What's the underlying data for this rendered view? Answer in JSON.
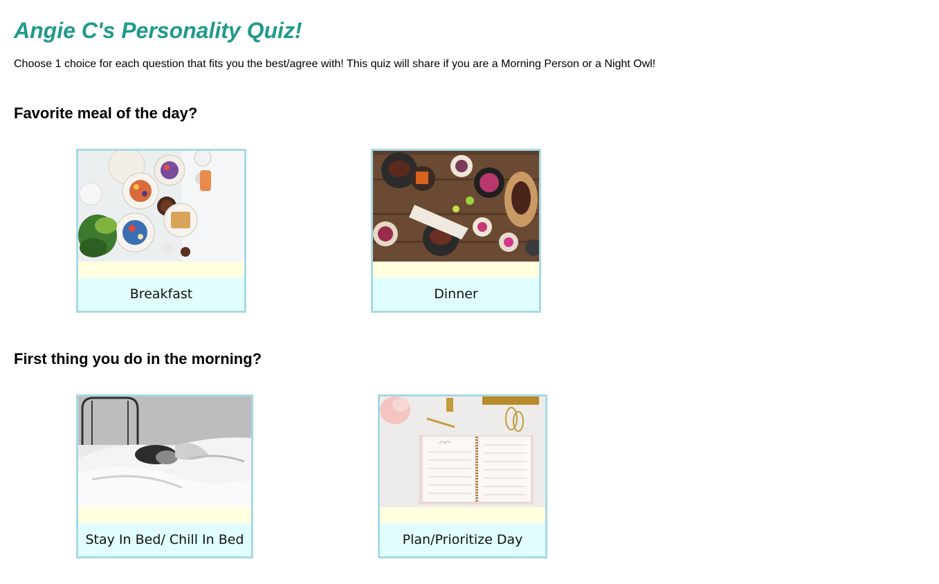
{
  "quiz": {
    "title": "Angie C's Personality Quiz!",
    "intro": "Choose 1 choice for each question that fits you the best/agree with! This quiz will share if you are a Morning Person or a Night Owl!"
  },
  "questions": [
    {
      "text": "Favorite meal of the day?",
      "choices": [
        {
          "label": "Breakfast",
          "image": "breakfast-table-photo"
        },
        {
          "label": "Dinner",
          "image": "dinner-table-photo"
        }
      ]
    },
    {
      "text": "First thing you do in the morning?",
      "choices": [
        {
          "label": "Stay In Bed/ Chill In Bed",
          "image": "person-in-bed-photo"
        },
        {
          "label": "Plan/Prioritize Day",
          "image": "planner-notebook-photo"
        }
      ]
    }
  ],
  "colors": {
    "title": "#1f9a8a",
    "card_border": "#a8d8e4",
    "card_strip": "#ffffe0",
    "card_label_bg": "#e0fefe"
  }
}
